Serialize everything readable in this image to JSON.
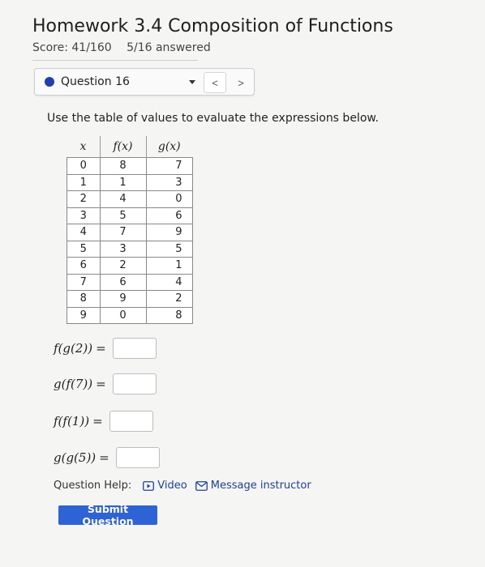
{
  "header": {
    "title": "Homework 3.4 Composition of Functions",
    "score": "Score: 41/160",
    "answered": "5/16 answered"
  },
  "question_nav": {
    "label": "Question 16",
    "prev": "<",
    "next": ">"
  },
  "instruction": "Use the table of values to evaluate the expressions below.",
  "table": {
    "headers": [
      "x",
      "f(x)",
      "g(x)"
    ],
    "rows": [
      [
        "0",
        "8",
        "7"
      ],
      [
        "1",
        "1",
        "3"
      ],
      [
        "2",
        "4",
        "0"
      ],
      [
        "3",
        "5",
        "6"
      ],
      [
        "4",
        "7",
        "9"
      ],
      [
        "5",
        "3",
        "5"
      ],
      [
        "6",
        "2",
        "1"
      ],
      [
        "7",
        "6",
        "4"
      ],
      [
        "8",
        "9",
        "2"
      ],
      [
        "9",
        "0",
        "8"
      ]
    ]
  },
  "expressions": [
    {
      "text": "f(g(2))",
      "equals": "=",
      "value": ""
    },
    {
      "text": "g(f(7))",
      "equals": "=",
      "value": ""
    },
    {
      "text": "f(f(1))",
      "equals": "=",
      "value": ""
    },
    {
      "text": "g(g(5))",
      "equals": "=",
      "value": ""
    }
  ],
  "help": {
    "label": "Question Help:",
    "video": "Video",
    "message": "Message instructor"
  },
  "submit_label": "Submit Question",
  "colors": {
    "accent": "#2e63d6",
    "question_dot": "#1f3fb0",
    "link": "#1f3f9f"
  },
  "icons": {
    "video": "play-box-icon",
    "message": "envelope-icon",
    "dropdown": "caret-down-icon"
  }
}
